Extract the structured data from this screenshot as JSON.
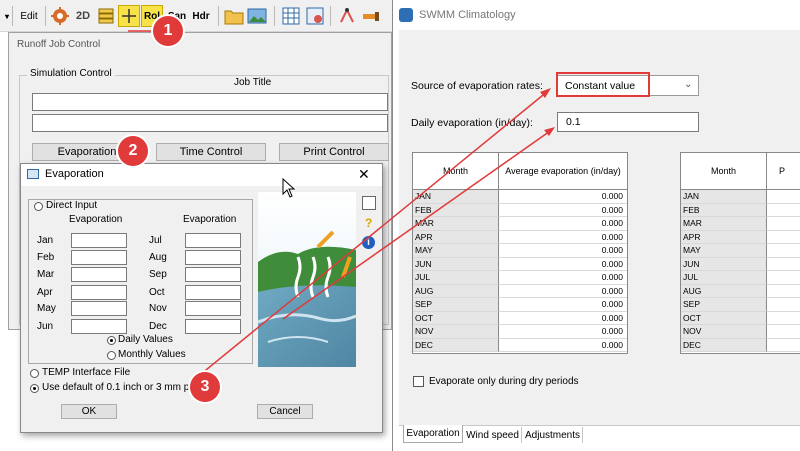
{
  "toolbar": {
    "edit_label": "Edit",
    "rol_label": "Rol",
    "san_label": "San",
    "hdr_label": "Hdr"
  },
  "runoff": {
    "title": "Runoff Job Control",
    "group_label": "Simulation Control",
    "job_title_label": "Job Title",
    "evaporation_button": "Evaporation",
    "time_control_button": "Time Control",
    "print_control_button": "Print Control"
  },
  "evap_dialog": {
    "title": "Evaporation",
    "close_glyph": "✕",
    "direct_input_label": "Direct Input",
    "col_header_left": "Evaporation",
    "col_header_right": "Evaporation",
    "months_left": [
      "Jan",
      "Feb",
      "Mar",
      "Apr",
      "May",
      "Jun"
    ],
    "months_right": [
      "Jul",
      "Aug",
      "Sep",
      "Oct",
      "Nov",
      "Dec"
    ],
    "daily_values_label": "Daily Values",
    "monthly_values_label": "Monthly Values",
    "temp_interface_label": "TEMP Interface File",
    "use_default_label": "Use default of 0.1 inch or 3 mm per day",
    "ok_button": "OK",
    "cancel_button": "Cancel",
    "side_help_glyph": "?",
    "side_info_glyph": "i"
  },
  "climatology": {
    "title": "SWMM Climatology",
    "source_label": "Source of evaporation rates:",
    "source_value": "Constant value",
    "daily_evap_label": "Daily evaporation (in/day):",
    "daily_evap_value": "0.1",
    "table1_headers": [
      "Month",
      "Average evaporation (in/day)"
    ],
    "table2_headers": [
      "Month",
      "P"
    ],
    "months": [
      "JAN",
      "FEB",
      "MAR",
      "APR",
      "MAY",
      "JUN",
      "JUL",
      "AUG",
      "SEP",
      "OCT",
      "NOV",
      "DEC"
    ],
    "values": [
      "0.000",
      "0.000",
      "0.000",
      "0.000",
      "0.000",
      "0.000",
      "0.000",
      "0.000",
      "0.000",
      "0.000",
      "0.000",
      "0.000"
    ],
    "dry_periods_label": "Evaporate only during dry periods",
    "tabs": [
      "Evaporation",
      "Wind speed",
      "Adjustments"
    ]
  },
  "annotations": [
    "1",
    "2",
    "3"
  ],
  "colors": {
    "highlight_red": "#e03a3a",
    "grid_gray": "#d8d8d8",
    "toolbar_yellow": "#f7e24a"
  }
}
